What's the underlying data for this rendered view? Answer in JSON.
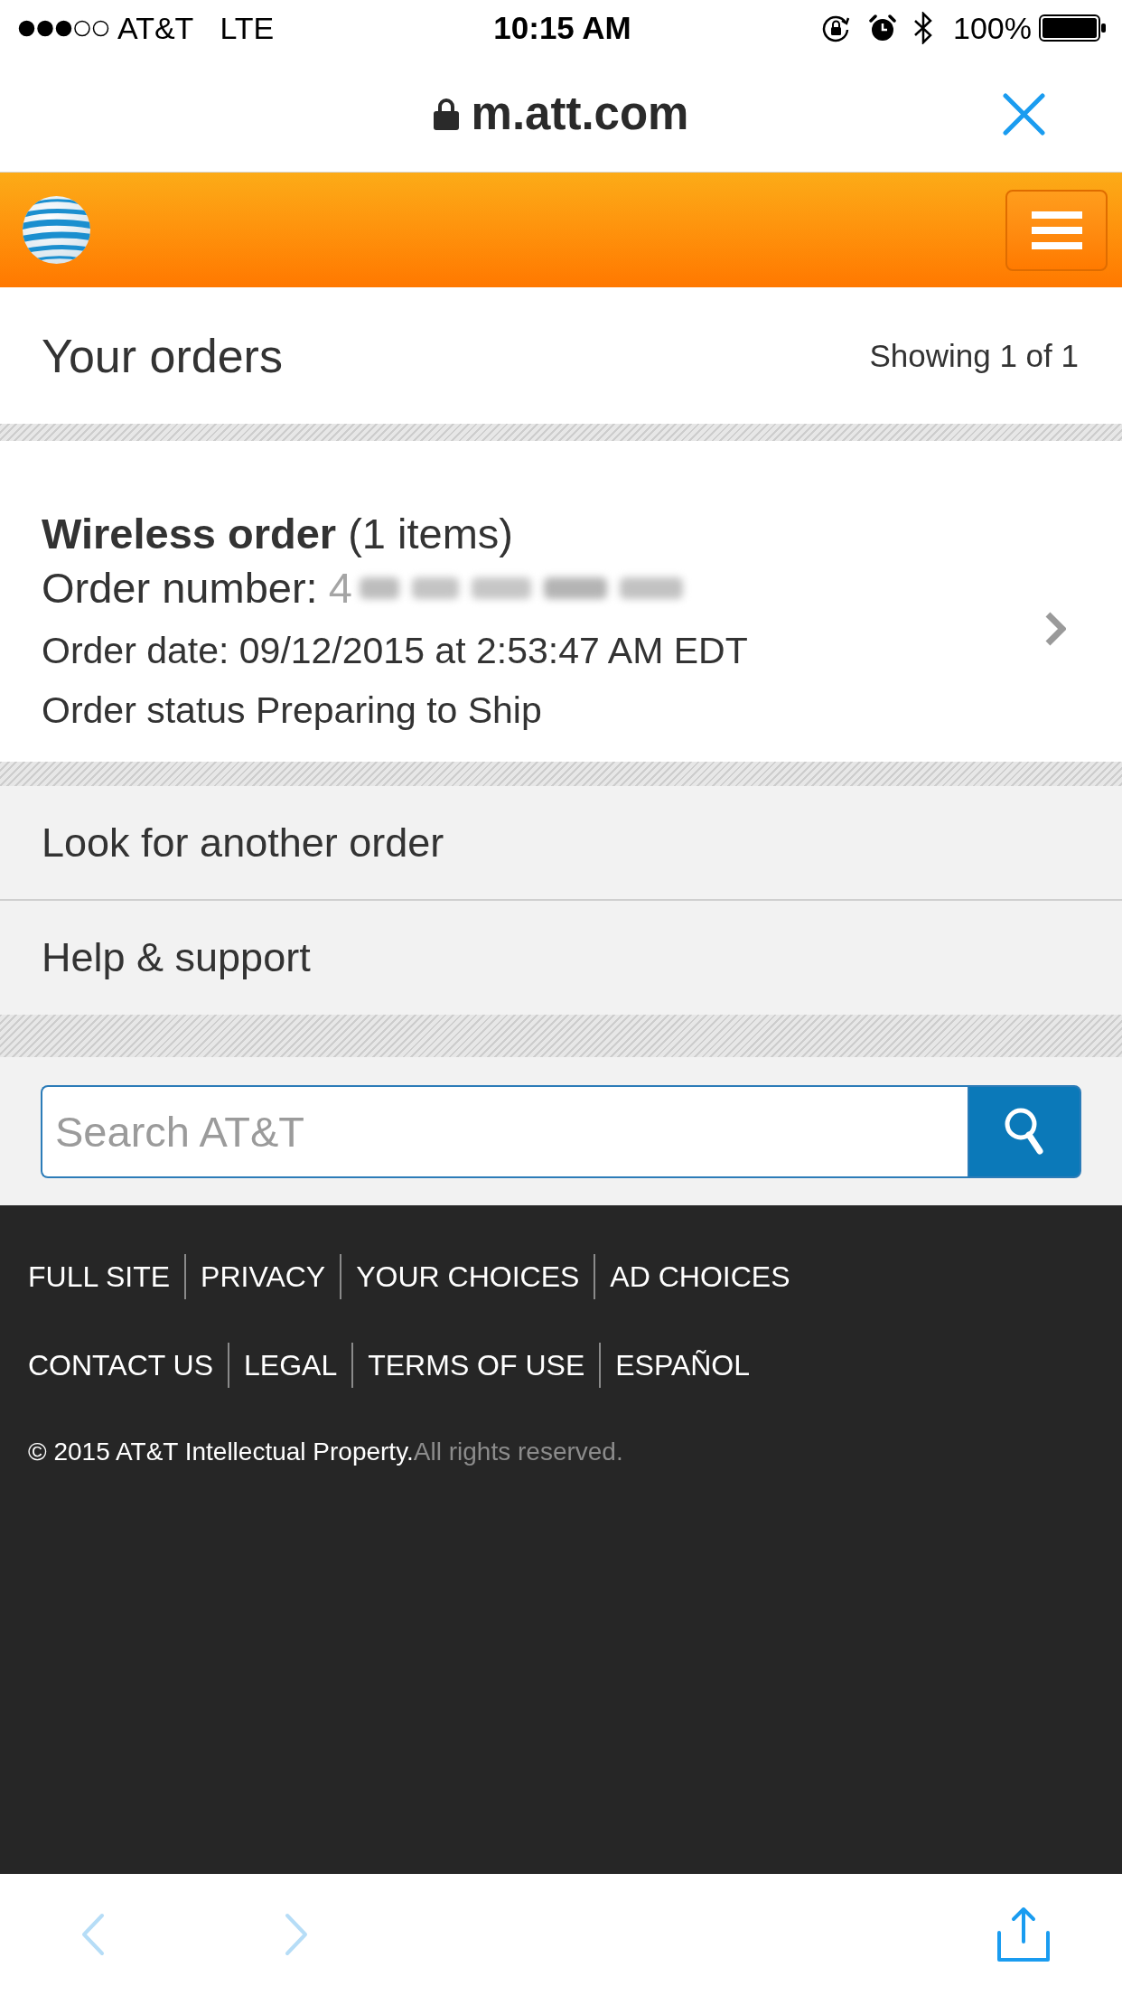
{
  "status_bar": {
    "carrier": "AT&T",
    "network": "LTE",
    "time": "10:15 AM",
    "battery": "100%"
  },
  "address_bar": {
    "url": "m.att.com"
  },
  "orders_header": {
    "title": "Your orders",
    "count": "Showing 1 of 1"
  },
  "orders": [
    {
      "title": "**Wireless order** (1 items)",
      "number_label": "Order number:",
      "number": "4",
      "date": "Order date: 09/12/2015 at 2:53:47 AM EDT",
      "status": "Order status Preparing to Ship"
    }
  ],
  "links": [
    "Look for another order",
    "Help & support"
  ],
  "search": {
    "placeholder": "Search AT&T"
  },
  "footer": {
    "link_rows": [
      [
        "FULL SITE",
        "PRIVACY",
        "YOUR CHOICES",
        "AD CHOICES"
      ],
      [
        "CONTACT US",
        "LEGAL",
        "TERMS OF USE",
        "ESPAÑOL"
      ]
    ],
    "copyright": "© 2015 AT&T Intellectual Property.",
    "rights": "All rights reserved."
  },
  "toolbar": {
    "back": {
      "disabled": true
    },
    "forward": {
      "disabled": true
    }
  }
}
